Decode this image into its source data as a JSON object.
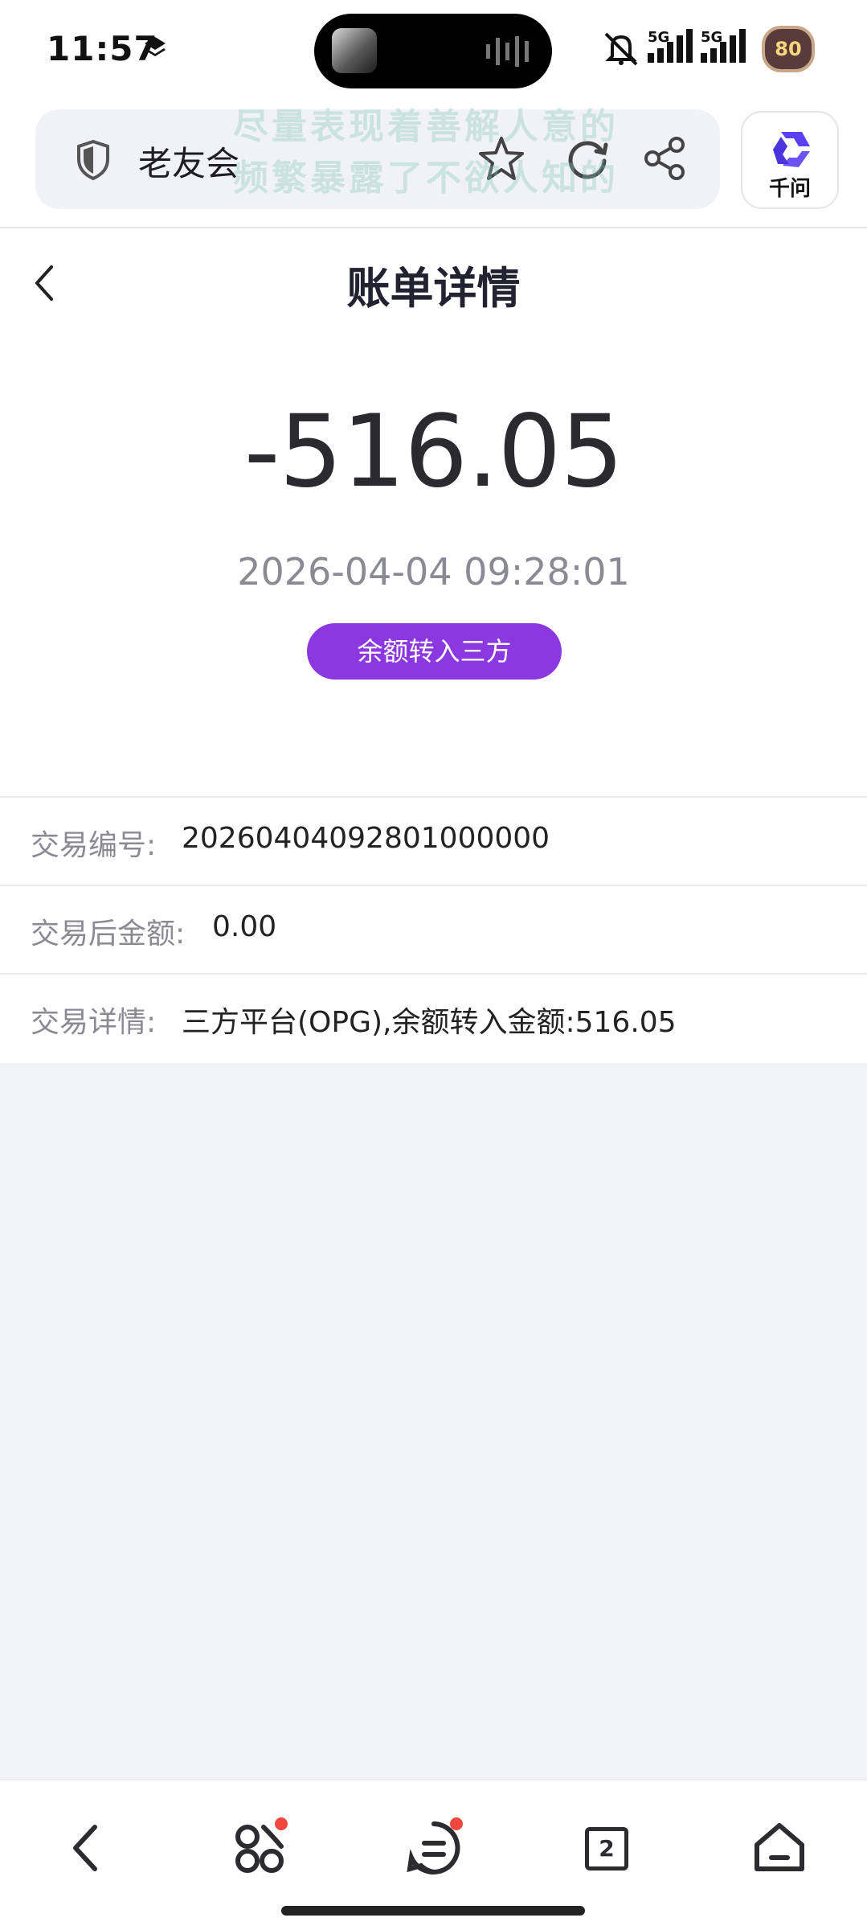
{
  "status_bar": {
    "time": "11:57",
    "signal_1_label": "5G",
    "signal_2_label": "5G",
    "battery": "80"
  },
  "browser": {
    "site_name": "老友会",
    "watermark_line1": "尽量表现着善解人意的",
    "watermark_line2": "频繁暴露了不欲人知的",
    "ai_label": "千问"
  },
  "page": {
    "title": "账单详情"
  },
  "bill": {
    "amount": "-516.05",
    "datetime": "2026-04-04 09:28:01",
    "type_badge": "余额转入三方"
  },
  "details": [
    {
      "label": "交易编号:",
      "value": "20260404092801000000"
    },
    {
      "label": "交易后金额:",
      "value": "0.00"
    },
    {
      "label": "交易详情:",
      "value": "三方平台(OPG),余额转入金额:516.05"
    }
  ],
  "bottom_nav": {
    "tabs_count": "2"
  },
  "colors": {
    "accent": "#8b38e0",
    "background": "#f2f3f7",
    "badge_dot": "#f2473f"
  }
}
